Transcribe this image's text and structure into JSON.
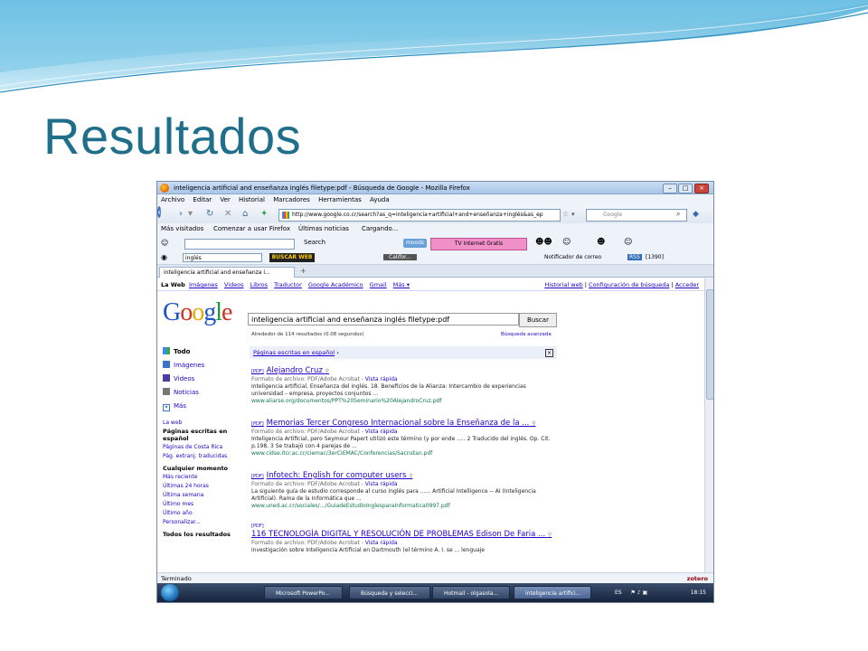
{
  "slide": {
    "title": "Resultados"
  },
  "window": {
    "title": "inteligencia artificial and enseñanza inglés filetype:pdf - Búsqueda de Google - Mozilla Firefox",
    "menu": [
      "Archivo",
      "Editar",
      "Ver",
      "Historial",
      "Marcadores",
      "Herramientas",
      "Ayuda"
    ],
    "url": "http://www.google.co.cr/search?as_q=inteligencia+artificial+and+enseñanza+inglés&as_ep",
    "search_placeholder": "Google",
    "bookmarks": [
      "Más visitados",
      "Comenzar a usar Firefox",
      "Últimas noticias",
      "Cargando..."
    ],
    "toolbar1": {
      "search_label": "Search",
      "moods_label": "moods",
      "tv_banner": "TV Internet Gratis"
    },
    "toolbar2": {
      "input_value": "inglés",
      "buscar_web": "BUSCAR WEB",
      "search_mini": "Califor...",
      "notifier": "Notificador de correo",
      "count": "[1390]"
    },
    "tab_label": "inteligencia artificial and enseñanza i...",
    "status_text": "Terminado",
    "zotero": "zotero"
  },
  "google": {
    "nav_left": [
      "La Web",
      "Imágenes",
      "Videos",
      "Libros",
      "Traductor",
      "Google Académico",
      "Gmail",
      "Más ▾"
    ],
    "nav_right": [
      "Historial web",
      "Configuración de búsqueda",
      "Acceder"
    ],
    "logo": "Google",
    "query": "inteligencia artificial and enseñanza inglés filetype:pdf",
    "search_button": "Buscar",
    "stats": "Alrededor de 114 resultados (0.08 segundos)",
    "advanced": "Búsqueda avanzada",
    "left_nav": [
      "Todo",
      "Imágenes",
      "Videos",
      "Noticias",
      "Más"
    ],
    "sidebar": {
      "web": "La web",
      "lang_head": "Páginas escritas en español",
      "country": "Páginas de Costa Rica",
      "translated": "Pág. extranj. traducidas",
      "time_head": "Cualquier momento",
      "time_items": [
        "Más reciente",
        "Últimas 24 horas",
        "Última semana",
        "Último mes",
        "Último año",
        "Personalizar..."
      ],
      "all_results": "Todos los resultados"
    },
    "refine": {
      "link": "Páginas escritas en español",
      "arrow": "›"
    },
    "results": [
      {
        "tag": "[PDF]",
        "title": "Alejandro Cruz",
        "format": "Formato de archivo: PDF/Adobe Acrobat - ",
        "quick": "Vista rápida",
        "snippet": "Inteligencia artificial. Enseñanza del inglés. 18. Beneficios de la Alianza: Intercambio de experiencias universidad – empresa, proyectos conjuntos ...",
        "url": "www.aliarse.org/documentos/PPT%20Seminario%20AlejandroCruz.pdf"
      },
      {
        "tag": "[PDF]",
        "title": "Memorias Tercer Congreso Internacional sobre la Enseñanza de la ...",
        "format": "Formato de archivo: PDF/Adobe Acrobat - ",
        "quick": "Vista rápida",
        "snippet": "Inteligencia Artificial, pero Seymour Papert utilizó este término (y por ende ..... 2 Traducido del inglés. Op. Cit. p.198. 3 Se trabajó con 4 parejas de ...",
        "url": "www.cidse.itcr.ac.cr/ciemac/3erCIEMAC/Conferencias/Sacnstan.pdf"
      },
      {
        "tag": "[PDF]",
        "title": "Infotech: English for computer users",
        "format": "Formato de archivo: PDF/Adobe Acrobat - ",
        "quick": "Vista rápida",
        "snippet": "La siguiente guía de estudio corresponde al curso Inglés para ...... Artificial Intelligence -- AI (Inteligencia Artificial). Rama de la Informática que ...",
        "url": "www.uned.ac.cr/sociales/.../GuiadeEstudioInglesparaInformatica0997.pdf"
      },
      {
        "tag": "[PDF]",
        "title": "116 TECNOLOGÍA DIGITAL Y RESOLUCIÓN DE PROBLEMAS Edison De Faria ...",
        "format": "Formato de archivo: PDF/Adobe Acrobat - ",
        "quick": "Vista rápida",
        "snippet": "investigación sobre Inteligencia Artificial en Dartmouth (el término A. I. se ... lenguaje",
        "url": ""
      }
    ]
  },
  "taskbar": {
    "buttons": [
      "Microsoft PowerPo...",
      "Búsqueda y selecci...",
      "Hotmail - olgasola...",
      "inteligencia artifici..."
    ],
    "lang": "ES",
    "clock": "18:15"
  },
  "colors": {
    "title": "#1f6f8b",
    "link": "#2200cc",
    "url_green": "#0e774a"
  }
}
